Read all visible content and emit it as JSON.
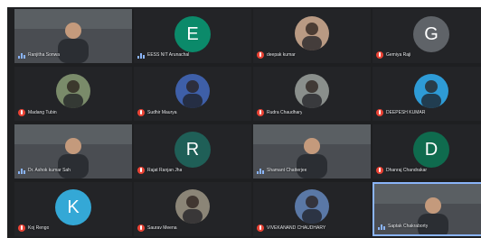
{
  "meeting": {
    "participants": [
      {
        "name": "Ranjitha Sonwa",
        "kind": "video",
        "mic": "live",
        "avatar_icon": "person-video"
      },
      {
        "name": "EESS NIT Arunachal",
        "kind": "letter",
        "letter": "E",
        "color": "#0b8a6a",
        "mic": "live"
      },
      {
        "name": "deepak kumar",
        "kind": "photo",
        "mic": "off",
        "photo_tone": "#b99a83"
      },
      {
        "name": "Gemiya Raji",
        "kind": "letter",
        "letter": "G",
        "color": "#5f6368",
        "mic": "off"
      },
      {
        "name": "Madang Tubin",
        "kind": "photo",
        "mic": "off",
        "photo_tone": "#7a8b6a"
      },
      {
        "name": "Sudhir Maurya",
        "kind": "photo",
        "mic": "off",
        "photo_tone": "#3e5fa8"
      },
      {
        "name": "Rudra Chaudhary",
        "kind": "photo",
        "mic": "off",
        "photo_tone": "#8a8f8c"
      },
      {
        "name": "DEEPESH KUMAR",
        "kind": "photo",
        "mic": "off",
        "photo_tone": "#2e9bd6"
      },
      {
        "name": "Dr. Ashok kumar Sah",
        "kind": "video",
        "mic": "live",
        "avatar_icon": "person-video"
      },
      {
        "name": "Rajat Ranjan Jha",
        "kind": "letter",
        "letter": "R",
        "color": "#1f5f57",
        "mic": "off"
      },
      {
        "name": "Shamant Chatterjee",
        "kind": "video",
        "mic": "live",
        "avatar_icon": "person-video"
      },
      {
        "name": "Dhanraj Chandrakar",
        "kind": "letter",
        "letter": "D",
        "color": "#0f6b4e",
        "mic": "off"
      },
      {
        "name": "Koj Rengo",
        "kind": "letter",
        "letter": "K",
        "color": "#34a8d6",
        "mic": "off"
      },
      {
        "name": "Saurav Meena",
        "kind": "photo",
        "mic": "off",
        "photo_tone": "#8b8577"
      },
      {
        "name": "VIVEKANAND CHAUDHARY",
        "kind": "photo",
        "mic": "off",
        "photo_tone": "#5a78a6"
      },
      {
        "name": "Saptak Chakraborty",
        "kind": "video",
        "mic": "live",
        "avatar_icon": "person-video",
        "active": true
      }
    ]
  }
}
